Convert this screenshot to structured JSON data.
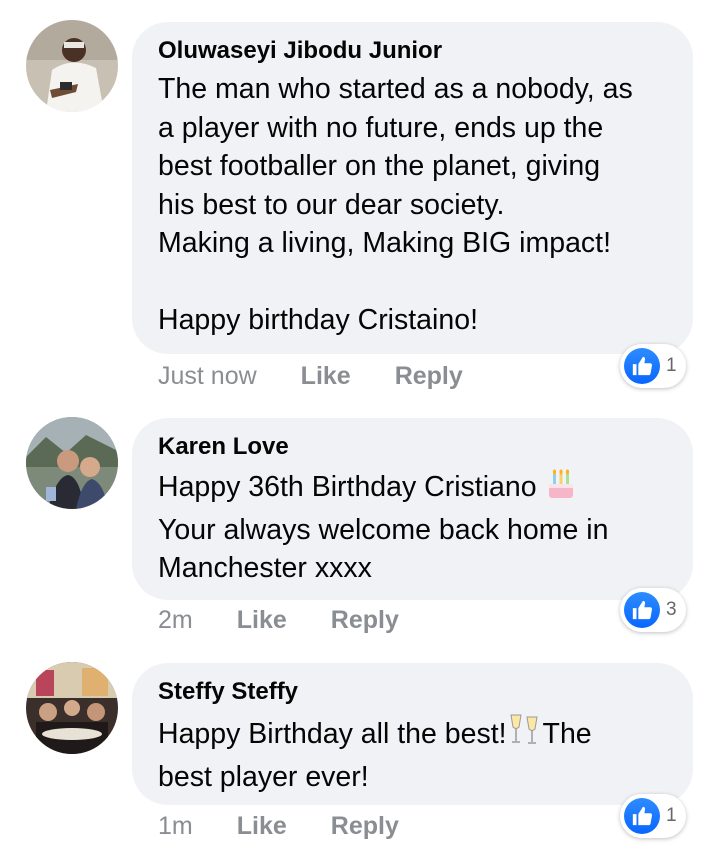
{
  "colors": {
    "bubble": "#f0f2f5",
    "accent": "#0866ff",
    "meta": "#8a8d91"
  },
  "comments": [
    {
      "author": "Oluwaseyi Jibodu Junior",
      "text": "The man who started as a nobody, as\na player with no future, ends up the\nbest footballer on the planet, giving\nhis best to our dear society.\nMaking a living, Making BIG impact!\n\nHappy birthday Cristaino!",
      "time": "Just now",
      "like_label": "Like",
      "reply_label": "Reply",
      "reaction_icon": "like-icon",
      "reaction_count": "1"
    },
    {
      "author": "Karen Love",
      "text_line1": "Happy 36th Birthday Cristiano",
      "text_line1_emoji": "birthday-cake-icon",
      "text_rest": "Your always welcome back home in\nManchester xxxx",
      "time": "2m",
      "like_label": "Like",
      "reply_label": "Reply",
      "reaction_icon": "like-icon",
      "reaction_count": "3"
    },
    {
      "author": "Steffy Steffy",
      "text_before_emoji": "Happy Birthday all the best!",
      "text_emoji": "champagne-glasses-icon",
      "text_after_emoji": "The",
      "text_rest": "best player ever!",
      "time": "1m",
      "like_label": "Like",
      "reply_label": "Reply",
      "reaction_icon": "like-icon",
      "reaction_count": "1"
    }
  ]
}
